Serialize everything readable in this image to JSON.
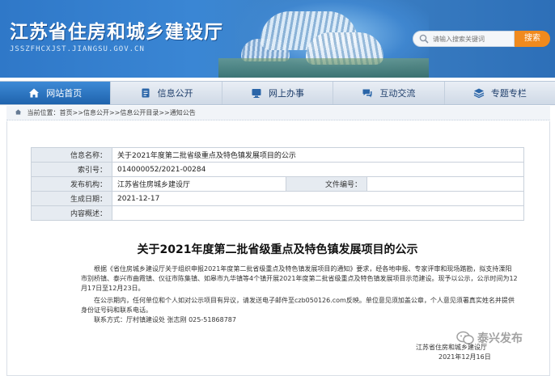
{
  "header": {
    "site_title": "江苏省住房和城乡建设厅",
    "site_url": "JSSZFHCXJST.JIANGSU.GOV.CN"
  },
  "search": {
    "placeholder": "请输入搜索关键词",
    "button_label": "搜索"
  },
  "nav": {
    "items": [
      {
        "label": "网站首页",
        "icon": "home-icon"
      },
      {
        "label": "信息公开",
        "icon": "document-icon"
      },
      {
        "label": "网上办事",
        "icon": "monitor-icon"
      },
      {
        "label": "互动交流",
        "icon": "chat-icon"
      },
      {
        "label": "专题专栏",
        "icon": "layers-icon"
      }
    ]
  },
  "breadcrumb": {
    "text": "当前位置：首页>>信息公开>>信息公开目录>>通知公告"
  },
  "meta": {
    "name_label": "信息名称：",
    "name_value": "关于2021年度第二批省级重点及特色镇发展项目的公示",
    "index_label": "索引号：",
    "index_value": "014000052/2021-00284",
    "org_label": "发布机构：",
    "org_value": "江苏省住房城乡建设厅",
    "docno_label": "文件编号：",
    "docno_value": "",
    "date_label": "生成日期：",
    "date_value": "2021-12-17",
    "summary_label": "内容概述：",
    "summary_value": ""
  },
  "article": {
    "title": "关于2021年度第二批省级重点及特色镇发展项目的公示",
    "p1": "根据《省住房城乡建设厅关于组织申报2021年度第二批省级重点及特色镇发展项目的通知》要求，经各地申报、专家评审和现场踏勘，拟支持溧阳市别桥镇、泰兴市曲霞镇、仪征市陈集镇、如皋市九华镇等4个镇开展2021年度第二批省级重点及特色镇发展项目示范建设。现予以公示，公示时间为12月17日至12月23日。",
    "p2": "在公示期内，任何单位和个人如对公示项目有异议，请发送电子邮件至czb050126.com反映。单位意见须加盖公章，个人意见须署真实姓名并提供身份证号码和联系电话。",
    "p3": "联系方式：厅村镇建设处 张志刚 025-51868787",
    "sig_org": "江苏省住房和城乡建设厅",
    "sig_date": "2021年12月16日"
  },
  "watermark": {
    "text": "泰兴发布"
  },
  "colors": {
    "header_blue": "#2f78c8",
    "nav_active": "#1f63ad",
    "search_button": "#f08a1e"
  }
}
